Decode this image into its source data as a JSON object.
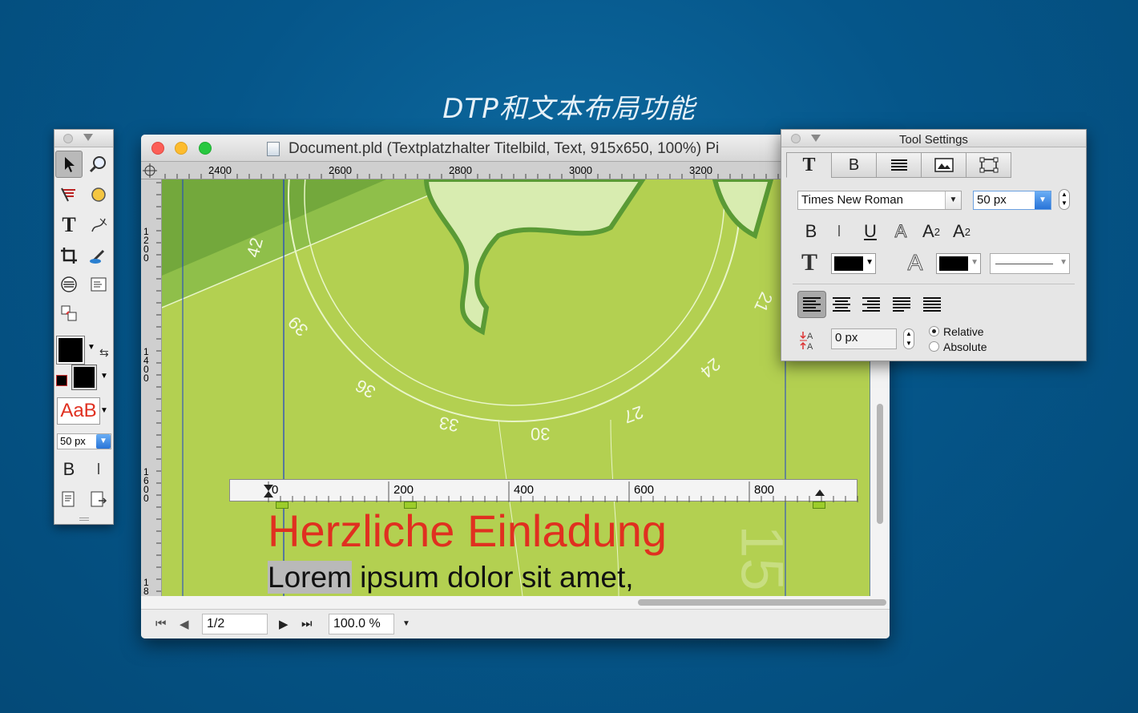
{
  "headline": "DTP和文本布局功能",
  "tools_palette": {
    "font_size": "50 px",
    "text_style_preview": "AaB",
    "bold_label": "B",
    "italic_label": "I"
  },
  "document": {
    "title": "Document.pld (Textplatzhalter Titelbild, Text, 915x650, 100%) Pi",
    "ruler_h_labels": [
      "2400",
      "2600",
      "2800",
      "3000",
      "3200"
    ],
    "ruler_v_labels": [
      "1200",
      "1400",
      "1600",
      "18"
    ],
    "dial_numbers": [
      "42",
      "39",
      "36",
      "33",
      "30",
      "27",
      "24",
      "21",
      "15"
    ],
    "text_ruler_labels": [
      "0",
      "200",
      "400",
      "600",
      "800"
    ],
    "heading": "Herzliche Einladung",
    "body_line": "Lorem ipsum dolor sit amet,",
    "body_highlight": "Lorem",
    "page_field": "1/2",
    "zoom_field": "100.0 %",
    "canvas_color": "#b3d051",
    "heading_color": "#e03020"
  },
  "tool_settings": {
    "title": "Tool Settings",
    "tabs": [
      {
        "label": "T",
        "active": true
      },
      {
        "label": "B",
        "active": false
      },
      {
        "label": "paragraph-icon",
        "active": false
      },
      {
        "label": "image-frame-icon",
        "active": false
      },
      {
        "label": "frame-icon",
        "active": false
      }
    ],
    "font_family": "Times New Roman",
    "font_size": "50 px",
    "style_buttons": {
      "bold": "B",
      "italic": "I",
      "underline": "U",
      "outline": "A",
      "subscript": "A",
      "superscript": "A"
    },
    "text_color": "#000000",
    "outline_color": "#000000",
    "baseline_shift": "0 px",
    "radio_relative": "Relative",
    "radio_absolute": "Absolute",
    "selected_mode": "Relative"
  }
}
